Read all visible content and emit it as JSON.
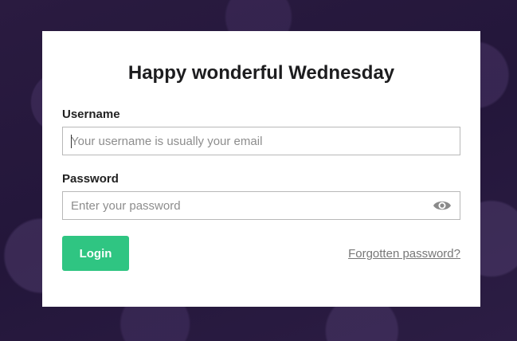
{
  "login": {
    "title": "Happy wonderful Wednesday",
    "username_label": "Username",
    "username_placeholder": "Your username is usually your email",
    "username_value": "",
    "password_label": "Password",
    "password_placeholder": "Enter your password",
    "password_value": "",
    "login_label": "Login",
    "forgot_label": "Forgotten password?",
    "show_password_icon": "eye-icon"
  },
  "colors": {
    "background": "#23163a",
    "card": "#ffffff",
    "accent": "#2fc582",
    "link": "#777777"
  }
}
